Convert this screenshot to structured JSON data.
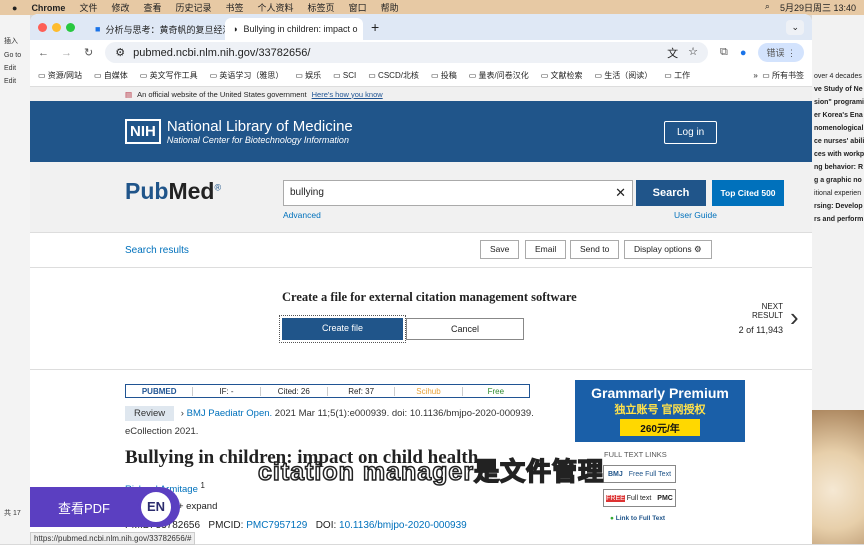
{
  "menubar": {
    "app": "Chrome",
    "items": [
      "文件",
      "修改",
      "查看",
      "历史记录",
      "书签",
      "个人资料",
      "标签页",
      "窗口",
      "帮助"
    ],
    "datetime": "5月29日周三 13:40"
  },
  "left_app": {
    "items": [
      "插入",
      "Go to",
      "Edit",
      "Edit"
    ],
    "footer": "共 17"
  },
  "right_app": {
    "lines": [
      "over 4 decades",
      "ve Study of Ne",
      "sion\" programi",
      "er Korea's Ena",
      "nomenological",
      "ce nurses' abili",
      "ces with workp",
      "ng behavior: R",
      "g a graphic no",
      "itional experien",
      "rsing: Develop",
      "rs and perform"
    ]
  },
  "tabs": [
    {
      "title": "分析与思考：黄奇帆的复旦经济"
    },
    {
      "title": "Bullying in children: impact o",
      "active": true
    }
  ],
  "address": {
    "url": "pubmed.ncbi.nlm.nih.gov/33782656/",
    "account": "错误"
  },
  "bookmarks": [
    "资源/网站",
    "自媒体",
    "英文写作工具",
    "英语学习（雅思）",
    "娱乐",
    "SCI",
    "CSCD/北核",
    "投稿",
    "量表/问卷汉化",
    "文献检索",
    "生活（阅读）",
    "工作"
  ],
  "bookmarks_more": "»",
  "bookmarks_all": "所有书签",
  "gov_banner": {
    "text": "An official website of the United States government",
    "link": "Here's how you know"
  },
  "nlm": {
    "logo": "NIH",
    "title": "National Library of Medicine",
    "subtitle": "National Center for Biotechnology Information",
    "login": "Log in"
  },
  "search": {
    "logo_pub": "Pub",
    "logo_med": "Med",
    "value": "bullying",
    "button": "Search",
    "top_cited": "Top Cited 500",
    "advanced": "Advanced",
    "user_guide": "User Guide"
  },
  "toolbar": {
    "search_results": "Search results",
    "save": "Save",
    "email": "Email",
    "send_to": "Send to",
    "display_options": "Display options"
  },
  "citation": {
    "heading": "Create a file for external citation management software",
    "create": "Create file",
    "cancel": "Cancel",
    "next_label": "NEXT RESULT",
    "position": "2 of 11,943"
  },
  "pmbar": {
    "logo": "PUBMED",
    "if": "IF: -",
    "cited": "Cited: 26",
    "ref": "Ref: 37",
    "scihub": "Scihub",
    "free": "Free"
  },
  "article": {
    "type": "Review",
    "journal": "BMJ Paediatr Open.",
    "citation": "2021 Mar 11;5(1):e000939. doi: 10.1136/bmjpo-2020-000939. eCollection 2021.",
    "title": "Bullying in children: impact on child health",
    "author": "Richard Armitage",
    "author_sup": "1",
    "expand": "+ expand",
    "pmid": "PMID: 33782656",
    "pmcid_label": "PMCID:",
    "pmcid": "PMC7957129",
    "doi_label": "DOI:",
    "doi": "10.1136/bmjpo-2020-000939"
  },
  "ad": {
    "line1": "Grammarly Premium",
    "line2": "独立账号 官网授权",
    "price": "260元/年"
  },
  "fulltext": {
    "heading": "FULL TEXT LINKS",
    "bmj": "BMJ",
    "bmj_text": "Free Full Text",
    "pmc_free": "FREE",
    "pmc_text": "Full text",
    "pmc": "PMC",
    "link360": "Link to Full Text"
  },
  "overlay": {
    "subtitle": "citation manager是文件管理",
    "pdf_button": "查看PDF",
    "lang": "EN"
  },
  "status_url": "https://pubmed.ncbi.nlm.nih.gov/33782656/#"
}
